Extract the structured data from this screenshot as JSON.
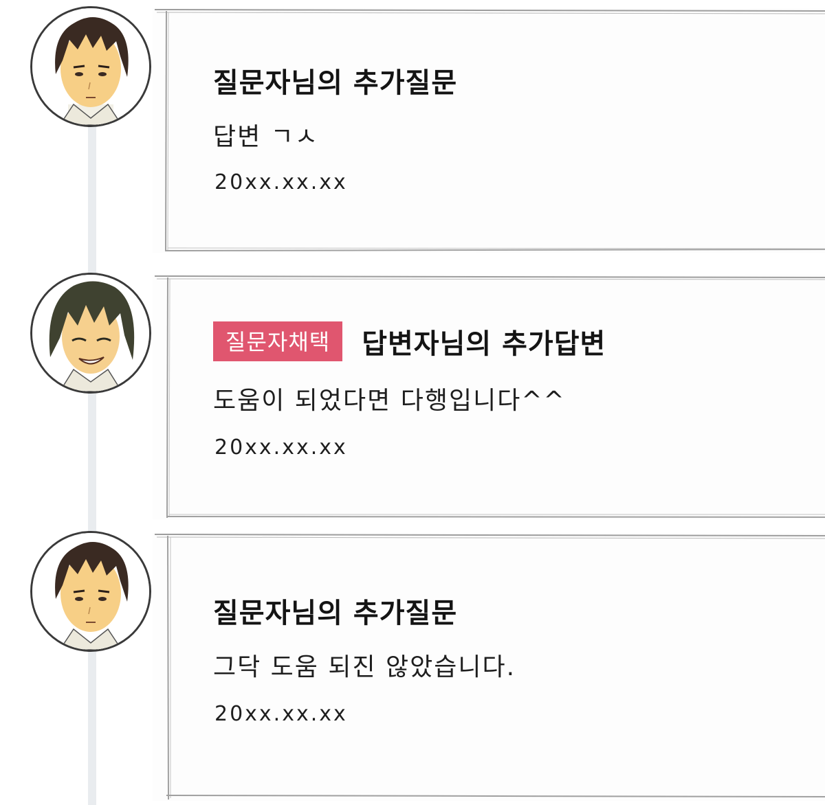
{
  "thread": {
    "entries": [
      {
        "avatar": "questioner-avatar",
        "title": "질문자님의 추가질문",
        "badge": "",
        "body": "답변 ㄱㅅ",
        "date": "20xx.xx.xx"
      },
      {
        "avatar": "answerer-avatar",
        "title": "답변자님의 추가답변",
        "badge": "질문자채택",
        "body": "도움이 되었다면 다행입니다^^",
        "date": "20xx.xx.xx"
      },
      {
        "avatar": "questioner-avatar",
        "title": "질문자님의 추가질문",
        "badge": "",
        "body": "그닥 도움 되진 않았습니다.",
        "date": "20xx.xx.xx"
      }
    ]
  },
  "colors": {
    "badge_background": "#e0566f",
    "card_border": "#9a9a9a",
    "timeline": "#e9ecef"
  }
}
